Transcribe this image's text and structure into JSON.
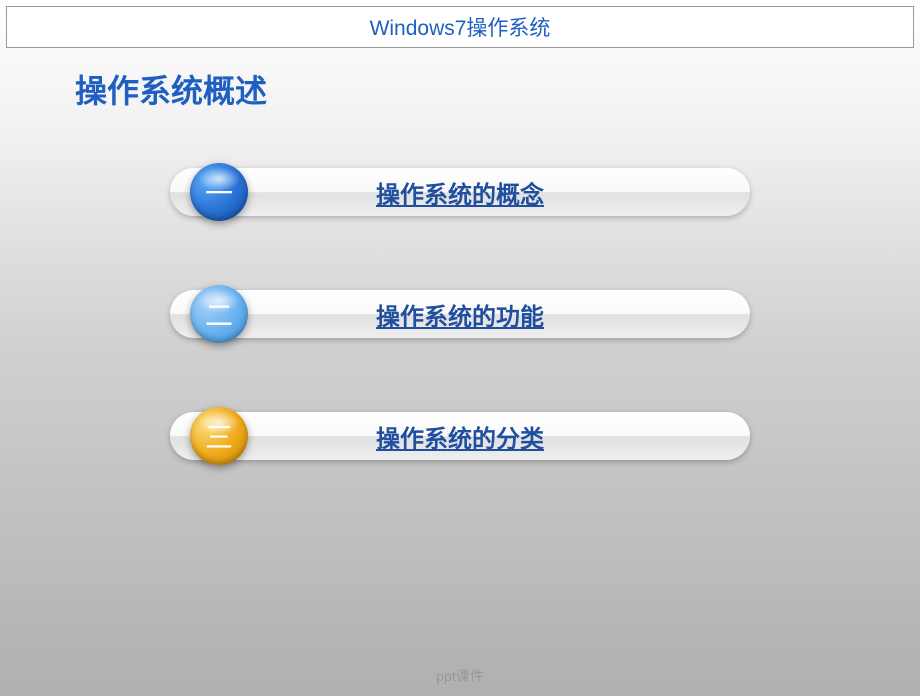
{
  "header": {
    "title": "Windows7操作系统"
  },
  "section": {
    "title": "操作系统概述"
  },
  "items": [
    {
      "num": "一",
      "label": "操作系统的概念"
    },
    {
      "num": "二",
      "label": "操作系统的功能"
    },
    {
      "num": "三",
      "label": "操作系统的分类"
    }
  ],
  "footer": {
    "text": "ppt课件"
  }
}
